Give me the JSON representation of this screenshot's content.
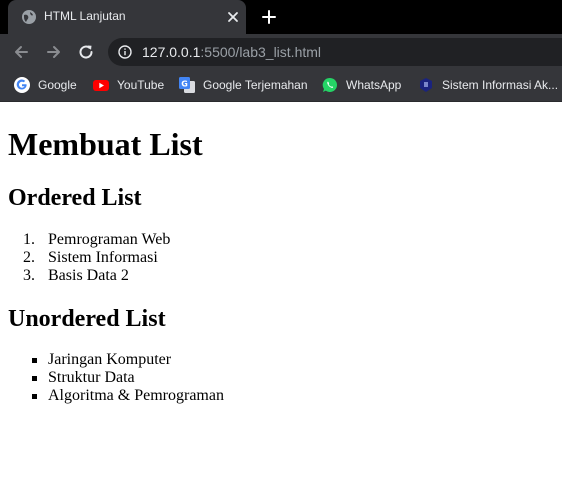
{
  "browser": {
    "tab": {
      "title": "HTML Lanjutan"
    },
    "address": {
      "host": "127.0.0.1",
      "rest": ":5500/lab3_list.html"
    },
    "bookmarks": [
      {
        "label": "Google",
        "icon": "google-icon"
      },
      {
        "label": "YouTube",
        "icon": "youtube-icon"
      },
      {
        "label": "Google Terjemahan",
        "icon": "google-translate-icon"
      },
      {
        "label": "WhatsApp",
        "icon": "whatsapp-icon"
      },
      {
        "label": "Sistem Informasi Ak...",
        "icon": "university-icon"
      }
    ]
  },
  "page": {
    "title": "Membuat List",
    "ordered": {
      "heading": "Ordered List",
      "items": [
        {
          "marker": "1.",
          "text": "Pemrograman Web"
        },
        {
          "marker": "2.",
          "text": "Sistem Informasi"
        },
        {
          "marker": "3.",
          "text": "Basis Data 2"
        }
      ]
    },
    "unordered": {
      "heading": "Unordered List",
      "items": [
        {
          "text": "Jaringan Komputer"
        },
        {
          "text": "Struktur Data"
        },
        {
          "text": "Algoritma & Pemrograman"
        }
      ]
    }
  },
  "colors": {
    "tabstrip": "#000000",
    "toolbar": "#35363a",
    "omnibox": "#202124",
    "chrome_text": "#e8eaed",
    "url_muted": "#9aa0a6"
  }
}
